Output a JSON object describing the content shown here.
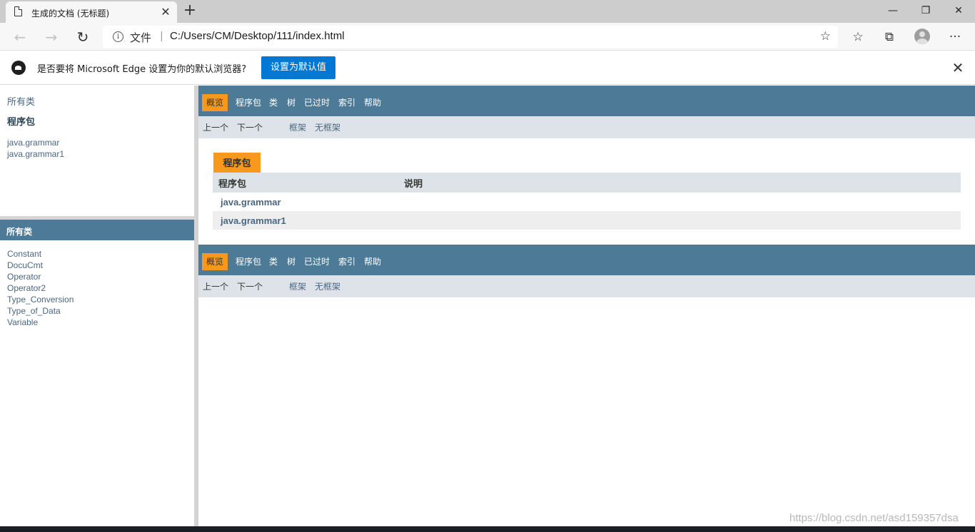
{
  "browser": {
    "tab_title": "生成的文档 (无标题)",
    "tab_close": "✕",
    "new_tab": "+",
    "scheme_label": "文件",
    "separator": "|",
    "url": "C:/Users/CM/Desktop/111/index.html",
    "window_controls": {
      "minimize": "—",
      "restore": "❐",
      "close": "✕"
    },
    "nav": {
      "back": "←",
      "forward": "→",
      "refresh": "↻"
    },
    "toolbar": {
      "favorites": "☆",
      "collections": "⧉",
      "more": "···"
    }
  },
  "infobar": {
    "message": "是否要将 Microsoft Edge 设置为你的默认浏览器?",
    "button_label": "设置为默认值",
    "close": "✕"
  },
  "left_top": {
    "all_classes_link": "所有类",
    "packages_heading": "程序包",
    "packages": [
      "java.grammar",
      "java.grammar1"
    ]
  },
  "left_bottom": {
    "heading": "所有类",
    "classes": [
      "Constant",
      "DocuCmt",
      "Operator",
      "Operator2",
      "Type_Conversion",
      "Type_of_Data",
      "Variable"
    ]
  },
  "nav": {
    "overview": "概览",
    "package": "程序包",
    "class": "类",
    "tree": "树",
    "deprecated": "已过时",
    "index": "索引",
    "help": "帮助",
    "prev": "上一个",
    "next": "下一个",
    "frames": "框架",
    "no_frames": "无框架"
  },
  "summary": {
    "caption": "程序包",
    "col_package": "程序包",
    "col_description": "说明",
    "rows": [
      {
        "package": "java.grammar",
        "description": ""
      },
      {
        "package": "java.grammar1",
        "description": ""
      }
    ]
  },
  "watermark": "https://blog.csdn.net/asd159357dsa",
  "colors": {
    "nav_bar": "#4d7a97",
    "active_tab": "#f8981d",
    "sub_nav": "#dee3e9",
    "link": "#4a6782",
    "edge_blue": "#0078d4"
  }
}
